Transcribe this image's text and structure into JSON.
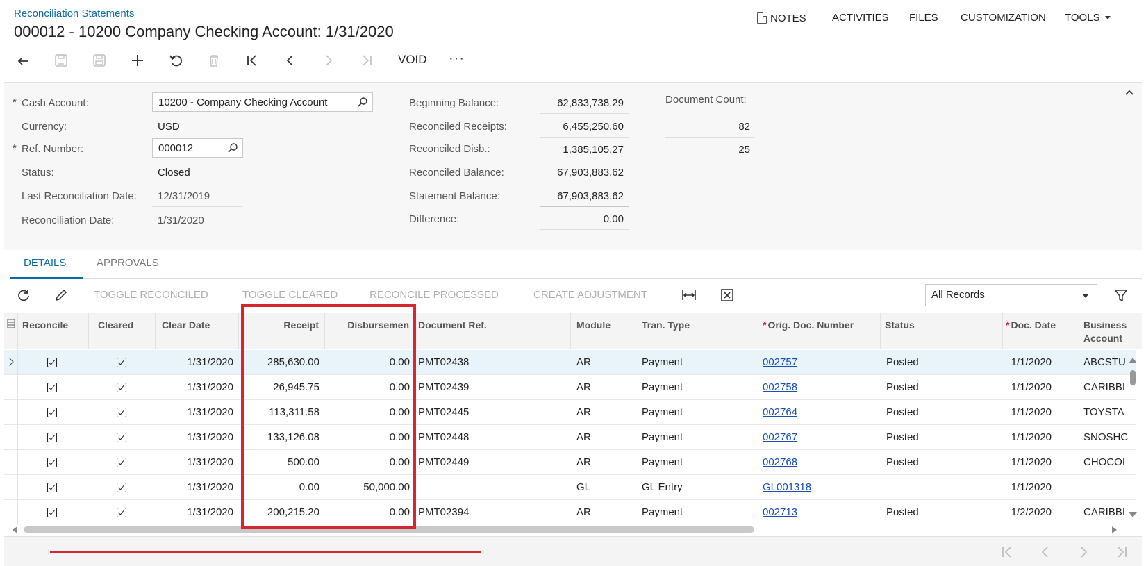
{
  "header": {
    "breadcrumb": "Reconciliation Statements",
    "title": "000012 - 10200 Company Checking Account: 1/31/2020",
    "menu": {
      "notes": "NOTES",
      "activities": "ACTIVITIES",
      "files": "FILES",
      "customization": "CUSTOMIZATION",
      "tools": "TOOLS"
    }
  },
  "toolbar": {
    "void_label": "VOID",
    "more_label": "···"
  },
  "form": {
    "cash_account_label": "Cash Account:",
    "cash_account_value": "10200 - Company Checking Account",
    "currency_label": "Currency:",
    "currency_value": "USD",
    "ref_number_label": "Ref. Number:",
    "ref_number_value": "000012",
    "status_label": "Status:",
    "status_value": "Closed",
    "last_recon_date_label": "Last Reconciliation Date:",
    "last_recon_date_value": "12/31/2019",
    "recon_date_label": "Reconciliation Date:",
    "recon_date_value": "1/31/2020",
    "beginning_balance_label": "Beginning Balance:",
    "beginning_balance_value": "62,833,738.29",
    "reconciled_receipts_label": "Reconciled Receipts:",
    "reconciled_receipts_value": "6,455,250.60",
    "reconciled_disb_label": "Reconciled Disb.:",
    "reconciled_disb_value": "1,385,105.27",
    "reconciled_balance_label": "Reconciled Balance:",
    "reconciled_balance_value": "67,903,883.62",
    "statement_balance_label": "Statement Balance:",
    "statement_balance_value": "67,903,883.62",
    "difference_label": "Difference:",
    "difference_value": "0.00",
    "document_count_label": "Document Count:",
    "document_count_receipts": "82",
    "document_count_disb": "25",
    "required_marker": "*"
  },
  "tabs": {
    "details": "DETAILS",
    "approvals": "APPROVALS"
  },
  "grid_toolbar": {
    "toggle_reconciled": "TOGGLE RECONCILED",
    "toggle_cleared": "TOGGLE CLEARED",
    "reconcile_processed": "RECONCILE PROCESSED",
    "create_adjustment": "CREATE ADJUSTMENT",
    "filter_value": "All Records"
  },
  "grid": {
    "columns": {
      "reconcile": "Reconcile",
      "cleared": "Cleared",
      "clear_date": "Clear Date",
      "receipt": "Receipt",
      "disbursement": "Disbursemen",
      "document_ref": "Document Ref.",
      "module": "Module",
      "tran_type": "Tran. Type",
      "orig_doc_number": "Orig. Doc. Number",
      "status": "Status",
      "doc_date": "Doc. Date",
      "business_account": "Business Account"
    },
    "rows": [
      {
        "clear_date": "1/31/2020",
        "receipt": "285,630.00",
        "disbursement": "0.00",
        "document_ref": "PMT02438",
        "module": "AR",
        "tran_type": "Payment",
        "orig_doc": "002757",
        "status": "Posted",
        "doc_date": "1/1/2020",
        "business_account": "ABCSTU"
      },
      {
        "clear_date": "1/31/2020",
        "receipt": "26,945.75",
        "disbursement": "0.00",
        "document_ref": "PMT02439",
        "module": "AR",
        "tran_type": "Payment",
        "orig_doc": "002758",
        "status": "Posted",
        "doc_date": "1/1/2020",
        "business_account": "CARIBBI"
      },
      {
        "clear_date": "1/31/2020",
        "receipt": "113,311.58",
        "disbursement": "0.00",
        "document_ref": "PMT02445",
        "module": "AR",
        "tran_type": "Payment",
        "orig_doc": "002764",
        "status": "Posted",
        "doc_date": "1/1/2020",
        "business_account": "TOYSTA"
      },
      {
        "clear_date": "1/31/2020",
        "receipt": "133,126.08",
        "disbursement": "0.00",
        "document_ref": "PMT02448",
        "module": "AR",
        "tran_type": "Payment",
        "orig_doc": "002767",
        "status": "Posted",
        "doc_date": "1/1/2020",
        "business_account": "SNOSHC"
      },
      {
        "clear_date": "1/31/2020",
        "receipt": "500.00",
        "disbursement": "0.00",
        "document_ref": "PMT02449",
        "module": "AR",
        "tran_type": "Payment",
        "orig_doc": "002768",
        "status": "Posted",
        "doc_date": "1/1/2020",
        "business_account": "CHOCOI"
      },
      {
        "clear_date": "1/31/2020",
        "receipt": "0.00",
        "disbursement": "50,000.00",
        "document_ref": "",
        "module": "GL",
        "tran_type": "GL Entry",
        "orig_doc": "GL001318",
        "status": "",
        "doc_date": "1/1/2020",
        "business_account": ""
      },
      {
        "clear_date": "1/31/2020",
        "receipt": "200,215.20",
        "disbursement": "0.00",
        "document_ref": "PMT02394",
        "module": "AR",
        "tran_type": "Payment",
        "orig_doc": "002713",
        "status": "Posted",
        "doc_date": "1/2/2020",
        "business_account": "CARIBBI"
      }
    ]
  },
  "colors": {
    "accent": "#0b6aa8",
    "link": "#1a4fb8",
    "annotation_red": "#d8262e"
  }
}
